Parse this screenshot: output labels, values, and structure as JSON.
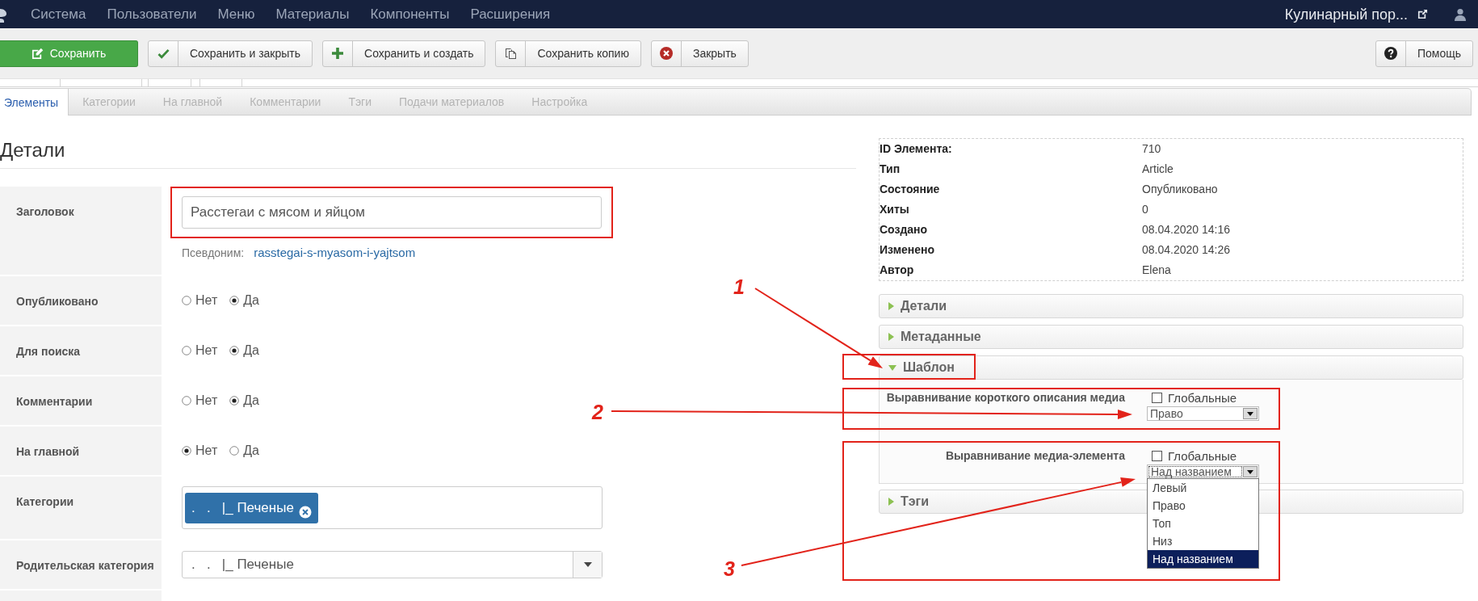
{
  "navbar": {
    "menu": [
      "Система",
      "Пользователи",
      "Меню",
      "Материалы",
      "Компоненты",
      "Расширения"
    ],
    "site_link": "Кулинарный пор..."
  },
  "toolbar": {
    "buttons": [
      {
        "kind": "save",
        "label": "Сохранить"
      },
      {
        "kind": "apply",
        "label": "Сохранить и закрыть"
      },
      {
        "kind": "new",
        "label": "Сохранить и создать"
      },
      {
        "kind": "copy",
        "label": "Сохранить копию"
      },
      {
        "kind": "cancel",
        "label": "Закрыть"
      }
    ],
    "help": {
      "label": "Помощь"
    }
  },
  "tabs": [
    {
      "label": "Элементы",
      "selected": true
    },
    {
      "label": "Категории",
      "selected": false
    },
    {
      "label": "На главной",
      "selected": false
    },
    {
      "label": "Комментарии",
      "selected": false
    },
    {
      "label": "Тэги",
      "selected": false
    },
    {
      "label": "Подачи материалов",
      "selected": false
    },
    {
      "label": "Настройка",
      "selected": false
    }
  ],
  "details": {
    "heading": "Детали",
    "fields": [
      {
        "kind": "text",
        "label": "Заголовок",
        "value": "Расстегаи с мясом и яйцом",
        "highlighted": true,
        "alias_label": "Псевдоним:",
        "alias": "rasstegai-s-myasom-i-yajtsom"
      },
      {
        "kind": "radio",
        "label": "Опубликовано",
        "options": [
          {
            "label": "Нет",
            "selected": false
          },
          {
            "label": "Да",
            "selected": true
          }
        ]
      },
      {
        "kind": "radio",
        "label": "Для поиска",
        "options": [
          {
            "label": "Нет",
            "selected": false
          },
          {
            "label": "Да",
            "selected": true
          }
        ]
      },
      {
        "kind": "radio",
        "label": "Комментарии",
        "options": [
          {
            "label": "Нет",
            "selected": false
          },
          {
            "label": "Да",
            "selected": true
          }
        ]
      },
      {
        "kind": "radio",
        "label": "На главной",
        "options": [
          {
            "label": "Нет",
            "selected": true
          },
          {
            "label": "Да",
            "selected": false
          }
        ]
      },
      {
        "kind": "tags",
        "label": "Категории",
        "tags": [
          ".   .   |_ Печеные"
        ]
      },
      {
        "kind": "select",
        "label": "Родительская категория",
        "value": ".   .   |_ Печеные"
      }
    ]
  },
  "info": [
    {
      "label": "ID Элемента:",
      "value": "710"
    },
    {
      "label": "Тип",
      "value": "Article"
    },
    {
      "label": "Состояние",
      "value": "Опубликовано"
    },
    {
      "label": "Хиты",
      "value": "0"
    },
    {
      "label": "Создано",
      "value": "08.04.2020 14:16"
    },
    {
      "label": "Изменено",
      "value": "08.04.2020 14:26"
    },
    {
      "label": "Автор",
      "value": "Elena"
    }
  ],
  "panels": [
    {
      "title": "Детали",
      "expanded": false
    },
    {
      "title": "Метаданные",
      "expanded": false
    },
    {
      "title": "Шаблон",
      "expanded": true,
      "highlighted": true,
      "fields": [
        {
          "label": "Выравнивание короткого описания медиа",
          "global_label": "Глобальные",
          "global_checked": false,
          "value": "Право",
          "open": false,
          "highlighted": true
        },
        {
          "label": "Выравнивание медиа-элемента",
          "global_label": "Глобальные",
          "global_checked": false,
          "value": "Над названием",
          "open": true,
          "highlighted": true,
          "options": [
            {
              "label": "Левый",
              "selected": false
            },
            {
              "label": "Право",
              "selected": false
            },
            {
              "label": "Топ",
              "selected": false
            },
            {
              "label": "Низ",
              "selected": false
            },
            {
              "label": "Над названием",
              "selected": true
            }
          ]
        }
      ]
    },
    {
      "title": "Тэги",
      "expanded": false
    }
  ],
  "callouts": [
    {
      "label": "1"
    },
    {
      "label": "2"
    },
    {
      "label": "3"
    }
  ]
}
